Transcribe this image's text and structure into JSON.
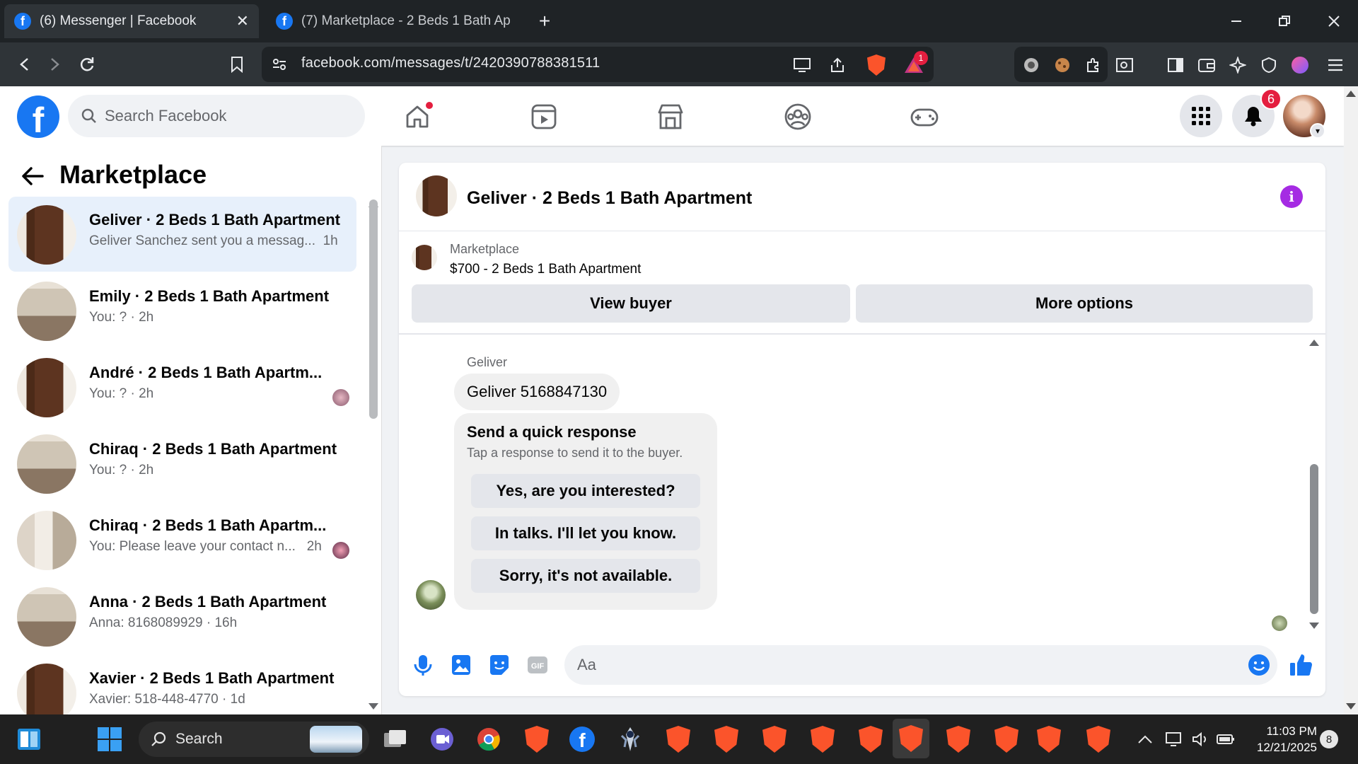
{
  "browser": {
    "tabs": [
      {
        "title": "(6) Messenger | Facebook",
        "active": true
      },
      {
        "title": "(7) Marketplace - 2 Beds 1 Bath Apart",
        "active": false
      }
    ],
    "url": "facebook.com/messages/t/2420390788381511",
    "brave_alert_count": "1"
  },
  "facebook": {
    "logo": "f",
    "search_placeholder": "Search Facebook",
    "notification_count": "6",
    "nav": [
      "home-icon",
      "video-icon",
      "marketplace-icon",
      "groups-icon",
      "gaming-icon"
    ]
  },
  "sidebar": {
    "title": "Marketplace",
    "conversations": [
      {
        "title": "Geliver · 2 Beds 1 Bath Apartment",
        "preview": "Geliver Sanchez sent you a messag...",
        "time": "1h",
        "selected": true
      },
      {
        "title": "Emily · 2 Beds 1 Bath Apartment",
        "preview": "You: ? · 2h",
        "time": ""
      },
      {
        "title": "André · 2 Beds 1 Bath Apartm...",
        "preview": "You: ? · 2h",
        "time": ""
      },
      {
        "title": "Chiraq · 2 Beds 1 Bath Apartment",
        "preview": "You: ? · 2h",
        "time": ""
      },
      {
        "title": "Chiraq · 2 Beds 1 Bath Apartm...",
        "preview": "You: Please leave your contact n...",
        "time": "2h"
      },
      {
        "title": "Anna · 2 Beds 1 Bath Apartment",
        "preview": "Anna: 8168089929 · 16h",
        "time": ""
      },
      {
        "title": "Xavier · 2 Beds 1 Bath Apartment",
        "preview": "Xavier: 518-448-4770 · 1d",
        "time": ""
      }
    ]
  },
  "chat": {
    "title": "Geliver · 2 Beds 1 Bath Apartment",
    "listing_category": "Marketplace",
    "listing_title": "$700 - 2 Beds 1 Bath Apartment",
    "view_buyer_label": "View buyer",
    "more_options_label": "More options",
    "sender_name": "Geliver",
    "message": "Geliver 5168847130",
    "quick_response": {
      "title": "Send a quick response",
      "subtitle": "Tap a response to send it to the buyer.",
      "options": [
        "Yes, are you interested?",
        "In talks. I'll let you know.",
        "Sorry, it's not available."
      ]
    },
    "input_placeholder": "Aa"
  },
  "taskbar": {
    "search_label": "Search",
    "time": "11:03 PM",
    "date": "12/21/2025",
    "notification_count": "8"
  },
  "colors": {
    "facebook_blue": "#1877f2",
    "brave_orange": "#fb542b",
    "info_purple": "#a52be3",
    "badge_red": "#e41e3f"
  }
}
